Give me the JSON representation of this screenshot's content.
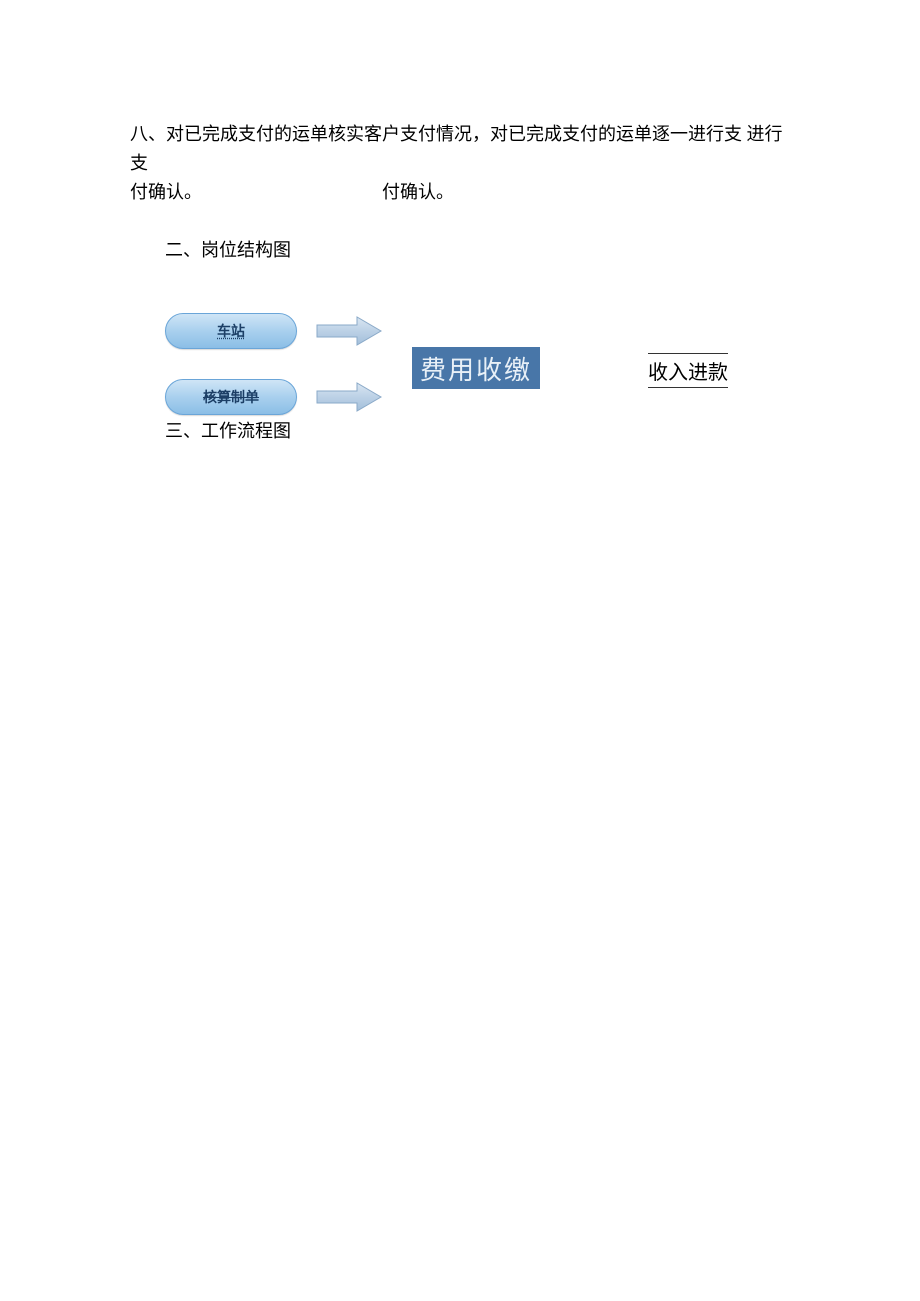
{
  "paragraph8": {
    "line1": "八、对已完成支付的运单核实客户支付情况，对已完成支付的运单逐一进行支 进行支",
    "line2_part1": "付确认。",
    "line2_part2": "付确认。"
  },
  "section2_title": "二、岗位结构图",
  "diagram": {
    "pill1": "车站",
    "pill2": "核算制单",
    "big_box": "费用收缴",
    "right_label": "收入进款"
  },
  "section3_title": "三、工作流程图"
}
